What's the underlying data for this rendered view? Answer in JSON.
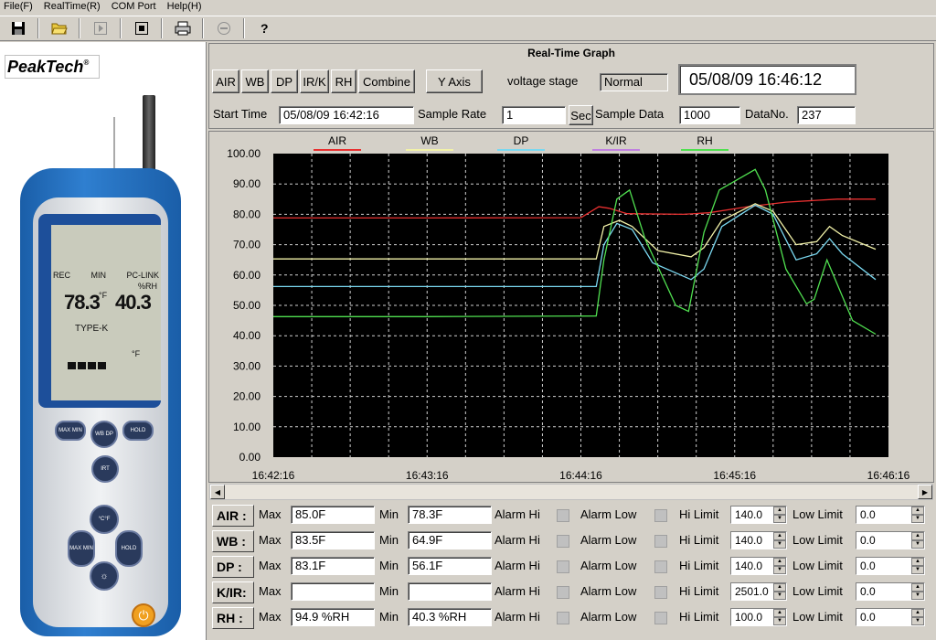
{
  "menu": [
    "File(F)",
    "RealTime(R)",
    "COM Port",
    "Help(H)"
  ],
  "toolbar": {
    "icons": [
      "save-icon",
      "open-folder-icon",
      "play-icon",
      "stop-icon",
      "print-icon",
      "minus-circle-icon",
      "help-icon"
    ]
  },
  "device": {
    "brand": "PeakTech",
    "lcd": {
      "rec": "REC",
      "min": "MIN",
      "pclink": "PC-LINK",
      "rh_unit": "%RH",
      "value1": "78.3",
      "value1_unit": "°F",
      "value2": "40.3",
      "type": "TYPE-K",
      "unit2": "°F"
    },
    "buttons": {
      "maxmin": "MAX MIN",
      "wbdp": "WB DP",
      "hold": "HOLD",
      "irt": "IRT",
      "cf": "°C°F",
      "maxmin2": "MAX MIN",
      "hold2": "HOLD"
    }
  },
  "header": {
    "title": "Real-Time Graph",
    "channel_buttons": [
      "AIR",
      "WB",
      "DP",
      "IR/K",
      "RH",
      "Combine"
    ],
    "yaxis_button": "Y Axis",
    "voltage_label": "voltage stage",
    "voltage_value": "Normal",
    "datetime": "05/08/09 16:46:12",
    "start_time_label": "Start Time",
    "start_time_value": "05/08/09 16:42:16",
    "sample_rate_label": "Sample Rate",
    "sample_rate_value": "1",
    "sec_button": "Sec",
    "sample_data_label": "Sample Data",
    "sample_data_value": "1000",
    "datano_label": "DataNo.",
    "datano_value": "237"
  },
  "colors": {
    "AIR": "#e83030",
    "WB": "#f2f2a8",
    "DP": "#7ad8f0",
    "K/IR": "#c080e0",
    "RH": "#50e050",
    "plot_bg": "#000000"
  },
  "chart_data": {
    "type": "line",
    "legend": [
      "AIR",
      "WB",
      "DP",
      "K/IR",
      "RH"
    ],
    "legend_colors": [
      "#e83030",
      "#f2f2a8",
      "#7ad8f0",
      "#c080e0",
      "#50e050"
    ],
    "xlabels": [
      "16:42:16",
      "16:43:16",
      "16:44:16",
      "16:45:16",
      "16:46:16"
    ],
    "ylabels": [
      "0.00",
      "10.00",
      "20.00",
      "30.00",
      "40.00",
      "50.00",
      "60.00",
      "70.00",
      "80.00",
      "90.00",
      "100.00"
    ],
    "ylim": [
      0,
      100
    ],
    "xlim_seconds": [
      0,
      240
    ],
    "grid": true,
    "series": [
      {
        "name": "AIR",
        "color": "#e83030",
        "points": [
          [
            0,
            78.8
          ],
          [
            60,
            78.8
          ],
          [
            120,
            78.9
          ],
          [
            127,
            82.5
          ],
          [
            131,
            82
          ],
          [
            138,
            80.2
          ],
          [
            160,
            80
          ],
          [
            170,
            80.5
          ],
          [
            185,
            82.5
          ],
          [
            200,
            84
          ],
          [
            220,
            85
          ],
          [
            235,
            85
          ]
        ]
      },
      {
        "name": "WB",
        "color": "#f2f2a8",
        "points": [
          [
            0,
            65.3
          ],
          [
            60,
            65.3
          ],
          [
            126,
            65.3
          ],
          [
            129,
            76
          ],
          [
            135,
            78
          ],
          [
            140,
            76
          ],
          [
            150,
            68
          ],
          [
            163,
            66
          ],
          [
            168,
            69
          ],
          [
            175,
            78
          ],
          [
            188,
            83.5
          ],
          [
            195,
            81
          ],
          [
            204,
            70
          ],
          [
            212,
            71
          ],
          [
            217,
            76
          ],
          [
            222,
            73
          ],
          [
            235,
            68.5
          ]
        ]
      },
      {
        "name": "DP",
        "color": "#7ad8f0",
        "points": [
          [
            0,
            56.2
          ],
          [
            60,
            56.2
          ],
          [
            126,
            56.2
          ],
          [
            129,
            70
          ],
          [
            134,
            77
          ],
          [
            140,
            75
          ],
          [
            148,
            64
          ],
          [
            163,
            58.5
          ],
          [
            168,
            62
          ],
          [
            175,
            76
          ],
          [
            188,
            83
          ],
          [
            195,
            80
          ],
          [
            204,
            65
          ],
          [
            212,
            67
          ],
          [
            217,
            72
          ],
          [
            222,
            67
          ],
          [
            235,
            58.5
          ]
        ]
      },
      {
        "name": "RH",
        "color": "#50e050",
        "points": [
          [
            0,
            46.3
          ],
          [
            60,
            46.3
          ],
          [
            126,
            46.5
          ],
          [
            129,
            65
          ],
          [
            134,
            85
          ],
          [
            139,
            88
          ],
          [
            145,
            72
          ],
          [
            157,
            50
          ],
          [
            162,
            48
          ],
          [
            168,
            74
          ],
          [
            174,
            88
          ],
          [
            188,
            94.8
          ],
          [
            192,
            88
          ],
          [
            200,
            62
          ],
          [
            208,
            50.5
          ],
          [
            211,
            52
          ],
          [
            216,
            65
          ],
          [
            220,
            57
          ],
          [
            226,
            45
          ],
          [
            235,
            40.5
          ]
        ]
      }
    ]
  },
  "grid_rows": [
    {
      "label": "AIR :",
      "max_label": "Max",
      "max": "85.0F",
      "min_label": "Min",
      "min": "78.3F",
      "alarm_hi": "Alarm Hi",
      "alarm_low": "Alarm Low",
      "hi_limit_label": "Hi Limit",
      "hi_limit": "140.0",
      "low_limit_label": "Low Limit",
      "low_limit": "0.0"
    },
    {
      "label": "WB :",
      "max_label": "Max",
      "max": "83.5F",
      "min_label": "Min",
      "min": "64.9F",
      "alarm_hi": "Alarm Hi",
      "alarm_low": "Alarm Low",
      "hi_limit_label": "Hi Limit",
      "hi_limit": "140.0",
      "low_limit_label": "Low Limit",
      "low_limit": "0.0"
    },
    {
      "label": "DP :",
      "max_label": "Max",
      "max": "83.1F",
      "min_label": "Min",
      "min": "56.1F",
      "alarm_hi": "Alarm Hi",
      "alarm_low": "Alarm Low",
      "hi_limit_label": "Hi Limit",
      "hi_limit": "140.0",
      "low_limit_label": "Low Limit",
      "low_limit": "0.0"
    },
    {
      "label": "K/IR:",
      "max_label": "Max",
      "max": "",
      "min_label": "Min",
      "min": "",
      "alarm_hi": "Alarm Hi",
      "alarm_low": "Alarm Low",
      "hi_limit_label": "Hi Limit",
      "hi_limit": "2501.0",
      "low_limit_label": "Low Limit",
      "low_limit": "0.0"
    },
    {
      "label": "RH :",
      "max_label": "Max",
      "max": "94.9 %RH",
      "min_label": "Min",
      "min": "40.3 %RH",
      "alarm_hi": "Alarm Hi",
      "alarm_low": "Alarm Low",
      "hi_limit_label": "Hi Limit",
      "hi_limit": "100.0",
      "low_limit_label": "Low Limit",
      "low_limit": "0.0"
    }
  ]
}
